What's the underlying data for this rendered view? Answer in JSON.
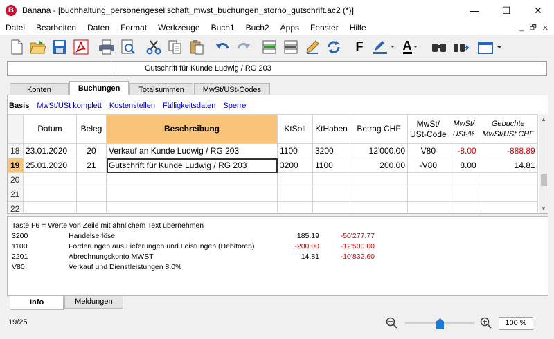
{
  "window": {
    "title": "Banana - [buchhaltung_personengesellschaft_mwst_buchungen_storno_gutschrift.ac2 (*)]",
    "app_icon_letter": "B",
    "minimize": "—",
    "maximize": "☐",
    "close": "✕"
  },
  "menu": {
    "items": [
      "Datei",
      "Bearbeiten",
      "Daten",
      "Format",
      "Werkzeuge",
      "Buch1",
      "Buch2",
      "Apps",
      "Fenster",
      "Hilfe"
    ],
    "right": [
      "_",
      "🗗",
      "✕"
    ]
  },
  "toolbar": {
    "icons": [
      "new-file-icon",
      "open-folder-icon",
      "save-icon",
      "pdf-icon",
      "print-icon",
      "print-preview-icon",
      "cut-icon",
      "copy-icon",
      "paste-icon",
      "undo-icon",
      "redo-icon",
      "insert-rows-icon",
      "delete-rows-icon",
      "edit-icon",
      "refresh-icon",
      "bold-icon",
      "highlight-color-icon",
      "font-color-icon",
      "find-icon",
      "find-next-icon",
      "window-icon"
    ],
    "bold_label": "F",
    "font_color_label": "A"
  },
  "cellbar": {
    "content": "Gutschrift für Kunde Ludwig / RG 203"
  },
  "tabs": [
    "Konten",
    "Buchungen",
    "Totalsummen",
    "MwSt/USt-Codes"
  ],
  "active_tab": "Buchungen",
  "views": [
    "Basis",
    "MwSt/USt komplett",
    "Kostenstellen",
    "Fälligkeitsdaten",
    "Sperre"
  ],
  "table": {
    "headers": {
      "datum": "Datum",
      "beleg": "Beleg",
      "beschreibung": "Beschreibung",
      "ktsoll": "KtSoll",
      "kthaben": "KtHaben",
      "betrag": "Betrag CHF",
      "mwst_code_1": "MwSt/",
      "mwst_code_2": "USt-Code",
      "mwst_pct_1": "MwSt/",
      "mwst_pct_2": "USt-%",
      "gebuchte_1": "Gebuchte",
      "gebuchte_2": "MwSt/USt CHF"
    },
    "rows": [
      {
        "nr": "18",
        "datum": "23.01.2020",
        "beleg": "20",
        "beschreibung": "Verkauf an Kunde Ludwig / RG 203",
        "ktsoll": "1100",
        "kthaben": "3200",
        "betrag": "12'000.00",
        "mwst_code": "V80",
        "mwst_pct": "-8.00",
        "gebucht": "-888.89"
      },
      {
        "nr": "19",
        "datum": "25.01.2020",
        "beleg": "21",
        "beschreibung": "Gutschrift für Kunde Ludwig / RG 203",
        "ktsoll": "3200",
        "kthaben": "1100",
        "betrag": "200.00",
        "mwst_code": "-V80",
        "mwst_pct": "8.00",
        "gebucht": "14.81"
      },
      {
        "nr": "20",
        "datum": "",
        "beleg": "",
        "beschreibung": "",
        "ktsoll": "",
        "kthaben": "",
        "betrag": "",
        "mwst_code": "",
        "mwst_pct": "",
        "gebucht": ""
      },
      {
        "nr": "21",
        "datum": "",
        "beleg": "",
        "beschreibung": "",
        "ktsoll": "",
        "kthaben": "",
        "betrag": "",
        "mwst_code": "",
        "mwst_pct": "",
        "gebucht": ""
      },
      {
        "nr": "22",
        "datum": "",
        "beleg": "",
        "beschreibung": "",
        "ktsoll": "",
        "kthaben": "",
        "betrag": "",
        "mwst_code": "",
        "mwst_pct": "",
        "gebucht": ""
      }
    ]
  },
  "info": {
    "hint": "Taste F6 = Werte von Zeile mit ähnlichem Text übernehmen",
    "lines": [
      {
        "code": "3200",
        "desc": "Handelserlöse",
        "amount": "185.19",
        "balance": "-50'277.77"
      },
      {
        "code": "1100",
        "desc": "Forderungen aus Lieferungen und Leistungen (Debitoren)",
        "amount": "-200.00",
        "balance": "-12'500.00"
      },
      {
        "code": "2201",
        "desc": "Abrechnungskonto MWST",
        "amount": "14.81",
        "balance": "-10'832.60"
      },
      {
        "code": "V80",
        "desc": "Verkauf und Dienstleistungen 8.0%",
        "amount": "",
        "balance": ""
      }
    ]
  },
  "bottom_tabs": [
    "Info",
    "Meldungen"
  ],
  "status": {
    "position": "19/25",
    "zoom": "100 %",
    "zoom_level": 0.5
  },
  "colors": {
    "selected_column": "#f7c47a",
    "negative": "#e00000",
    "link": "#0000cc",
    "slider": "#1e78d7"
  }
}
